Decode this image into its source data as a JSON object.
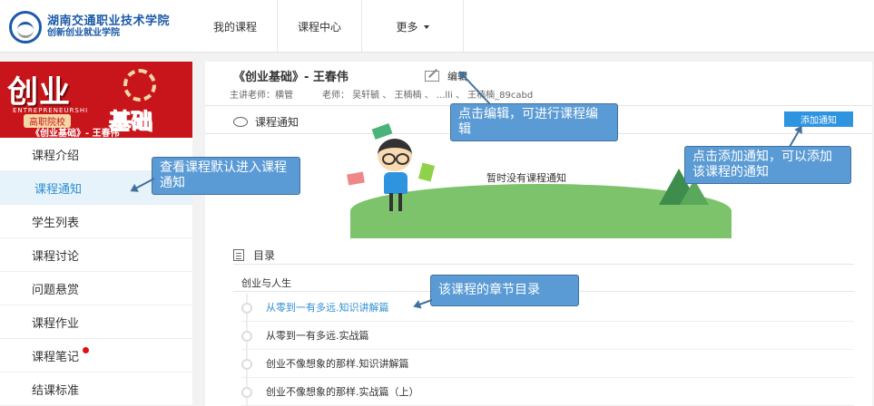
{
  "header": {
    "logo_line1": "湖南交通职业技术学院",
    "logo_line2": "创新创业就业学院",
    "nav": [
      "我的课程",
      "课程中心",
      "更多"
    ]
  },
  "sidebar": {
    "banner": {
      "title1": "创业",
      "title2": "基础",
      "english": "ENTREPRENEURSHI",
      "tag": "高职院校",
      "subtitle": "《创业基础》- 王春伟"
    },
    "items": [
      {
        "label": "课程介绍",
        "active": false
      },
      {
        "label": "课程通知",
        "active": true
      },
      {
        "label": "学生列表",
        "active": false
      },
      {
        "label": "课程讨论",
        "active": false
      },
      {
        "label": "问题悬赏",
        "active": false
      },
      {
        "label": "课程作业",
        "active": false
      },
      {
        "label": "课程笔记",
        "active": false,
        "badge": true
      },
      {
        "label": "结课标准",
        "active": false
      }
    ]
  },
  "course": {
    "title": "《创业基础》- 王春伟",
    "edit_label": "编辑",
    "main_teacher": "主讲老师：横管",
    "teachers": "老师：  吴轩毓 、  王楠楠 、  ...lli 、  王楠楠_89cabd"
  },
  "notice": {
    "heading": "课程通知",
    "add_button": "添加通知",
    "empty_text": "暂时没有课程通知"
  },
  "catalog": {
    "heading": "目录",
    "chapter": "创业与人生",
    "lessons": [
      {
        "title": "从零到一有多远.知识讲解篇",
        "active": true
      },
      {
        "title": "从零到一有多远.实战篇",
        "active": false
      },
      {
        "title": "创业不像想象的那样.知识讲解篇",
        "active": false
      },
      {
        "title": "创业不像想象的那样.实战篇（上）",
        "active": false
      }
    ]
  },
  "callouts": {
    "edit": "点击编辑，可进行课程编辑",
    "add": "点击添加通知，可以添加该课程的通知",
    "default": "查看课程默认进入课程通知",
    "catalog": "该课程的章节目录"
  },
  "colors": {
    "accent": "#2f94e0",
    "callout": "#5b9bd5",
    "brand": "#1c5aa8",
    "banner": "#c8151b"
  }
}
